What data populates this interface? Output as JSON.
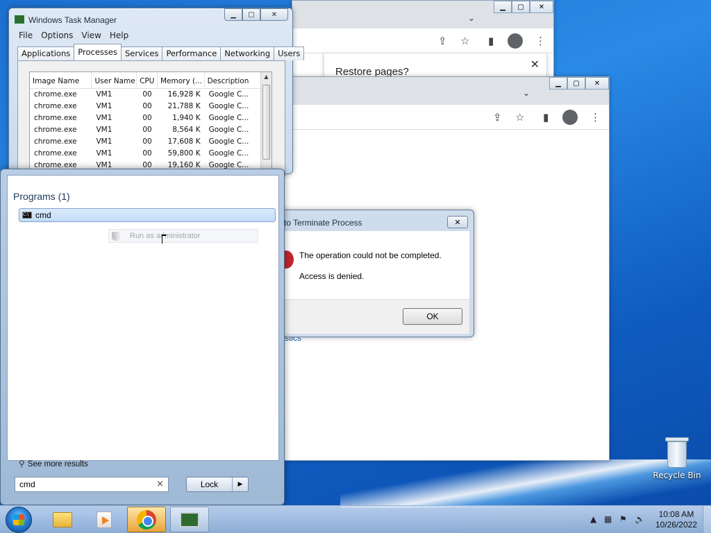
{
  "desktop": {
    "recycle_bin_label": "Recycle Bin"
  },
  "chrome_back": {
    "popup_title": "Restore pages?"
  },
  "chrome_front": {
    "link_fragment": "stics"
  },
  "task_manager": {
    "title": "Windows Task Manager",
    "menu": [
      "File",
      "Options",
      "View",
      "Help"
    ],
    "tabs": [
      "Applications",
      "Processes",
      "Services",
      "Performance",
      "Networking",
      "Users"
    ],
    "active_tab": "Processes",
    "columns": [
      "Image Name",
      "User Name",
      "CPU",
      "Memory (...",
      "Description"
    ],
    "rows": [
      [
        "chrome.exe",
        "VM1",
        "00",
        "16,928 K",
        "Google C..."
      ],
      [
        "chrome.exe",
        "VM1",
        "00",
        "21,788 K",
        "Google C..."
      ],
      [
        "chrome.exe",
        "VM1",
        "00",
        "1,940 K",
        "Google C..."
      ],
      [
        "chrome.exe",
        "VM1",
        "00",
        "8,564 K",
        "Google C..."
      ],
      [
        "chrome.exe",
        "VM1",
        "00",
        "17,608 K",
        "Google C..."
      ],
      [
        "chrome.exe",
        "VM1",
        "00",
        "59,800 K",
        "Google C..."
      ],
      [
        "chrome.exe",
        "VM1",
        "00",
        "19,160 K",
        "Google C..."
      ]
    ]
  },
  "error_dialog": {
    "title": "to Terminate Process",
    "message": "The operation could not be completed.",
    "detail": "Access is denied.",
    "ok_label": "OK"
  },
  "start_menu": {
    "group_label": "Programs (1)",
    "result_label": "cmd",
    "run_as_label": "Run as administrator",
    "see_more_label": "See more results",
    "search_value": "cmd",
    "lock_label": "Lock"
  },
  "taskbar": {
    "time": "10:08 AM",
    "date": "10/26/2022"
  },
  "colors": {
    "desktop_blue": "#1c6fd0",
    "selection_blue": "#c1dbf7",
    "error_red": "#c1272d",
    "active_task_orange": "#e7a43a"
  },
  "icons": [
    "start-orb",
    "folder-icon",
    "media-player-icon",
    "chrome-icon",
    "task-manager-icon",
    "recycle-bin-icon",
    "shield-icon",
    "search-icon",
    "error-icon"
  ]
}
